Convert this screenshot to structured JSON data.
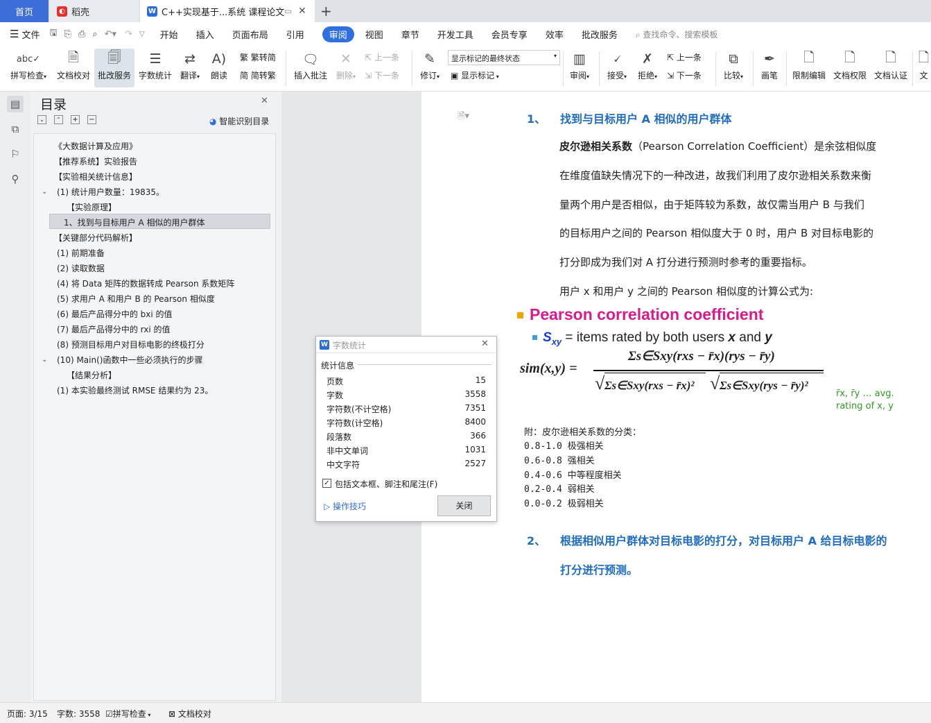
{
  "tabs": {
    "home": "首页",
    "daoke": "稻壳",
    "doc": "C++实现基于...系统 课程论文"
  },
  "menu": {
    "file": "文件",
    "items": [
      "开始",
      "插入",
      "页面布局",
      "引用",
      "审阅",
      "视图",
      "章节",
      "开发工具",
      "会员专享",
      "效率",
      "批改服务"
    ],
    "active": "审阅",
    "search_placeholder": "查找命令、搜索模板"
  },
  "ribbon": {
    "spell_check": "拼写检查",
    "doc_proof": "文档校对",
    "correction_service": "批改服务",
    "word_count": "字数统计",
    "translate": "翻译",
    "read_aloud": "朗读",
    "trad_to_simp": "繁转简",
    "simp_to_trad": "简转繁",
    "insert_comment": "插入批注",
    "delete": "删除",
    "prev": "上一条",
    "next": "下一条",
    "revise": "修订",
    "markup_state": "显示标记的最终状态",
    "show_markup": "显示标记",
    "review": "审阅",
    "accept": "接受",
    "reject": "拒绝",
    "prev2": "上一条",
    "next2": "下一条",
    "compare": "比较",
    "pen": "画笔",
    "restrict_edit": "限制编辑",
    "doc_permission": "文档权限",
    "doc_cert": "文档认证",
    "doc_more": "文"
  },
  "toc": {
    "title": "目录",
    "smart_label": "智能识别目录",
    "items": [
      "《大数据计算及应用》",
      "【推荐系统】实验报告",
      "【实验相关统计信息】",
      "(1) 统计用户数量：19835。",
      "【实验原理】",
      "1、找到与目标用户 A 相似的用户群体",
      "【关键部分代码解析】",
      "(1) 前期准备",
      "(2) 读取数据",
      "(4) 将 Data 矩阵的数据转成 Pearson 系数矩阵",
      "(5) 求用户 A 和用户 B 的 Pearson 相似度",
      "(6) 最后产品得分中的 bxi 的值",
      "(7) 最后产品得分中的 rxi 的值",
      "(8) 预测目标用户对目标电影的终极打分",
      "(10) Main()函数中一些必须执行的步骤",
      "【结果分析】",
      "(1) 本实验最终测试 RMSE 结果约为 23。"
    ]
  },
  "document": {
    "h1_num": "1、",
    "h1_text": "找到与目标用户 A 相似的用户群体",
    "p1_bold": "皮尔逊相关系数",
    "p1_line1_rest": "（Pearson Correlation Coefficient）是余弦相似度",
    "p1_line2": "在维度值缺失情况下的一种改进，故我们利用了皮尔逊相关系数来衡",
    "p1_line3": "量两个用户是否相似，由于矩阵较为系数，故仅需当用户 B 与我们",
    "p1_line4": "的目标用户之间的 Pearson 相似度大于 0 时，用户 B 对目标电影的",
    "p1_line5": "打分即成为我们对 A 打分进行预测时参考的重要指标。",
    "p2": "用户 x 和用户 y 之间的 Pearson 相似度的计算公式为:",
    "formula_title": "Pearson correlation coefficient",
    "formula_sub_s": "S",
    "formula_sub_xy": "xy",
    "formula_sub_text": " = items rated by both users ",
    "formula_sub_x": "x",
    "formula_sub_and": " and ",
    "formula_sub_y": "y",
    "formula_lhs": "sim(x,y) =",
    "formula_num": "Σs∈Sxy(rxs − r̄x)(rys − r̄y)",
    "formula_den1": "Σs∈Sxy(rxs − r̄x)²",
    "formula_den2": "Σs∈Sxy(rys − r̄y)²",
    "formula_note1": "r̄x, r̄y … avg.",
    "formula_note2": "rating of x, y",
    "appendix_title": "附：皮尔逊相关系数的分类：",
    "appendix": [
      "0.8-1.0 极强相关",
      "0.6-0.8 强相关",
      "0.4-0.6 中等程度相关",
      "0.2-0.4 弱相关",
      "0.0-0.2 极弱相关"
    ],
    "h2_num": "2、",
    "h2_line1": "根据相似用户群体对目标电影的打分，对目标用户 A 给目标电影的",
    "h2_line2": "打分进行预测。"
  },
  "dialog": {
    "title": "字数统计",
    "section": "统计信息",
    "rows": [
      {
        "label": "页数",
        "value": "15"
      },
      {
        "label": "字数",
        "value": "3558"
      },
      {
        "label": "字符数(不计空格)",
        "value": "7351"
      },
      {
        "label": "字符数(计空格)",
        "value": "8400"
      },
      {
        "label": "段落数",
        "value": "366"
      },
      {
        "label": "非中文单词",
        "value": "1031"
      },
      {
        "label": "中文字符",
        "value": "2527"
      }
    ],
    "checkbox_label": "包括文本框、脚注和尾注(F)",
    "tips": "操作技巧",
    "close": "关闭"
  },
  "status": {
    "page": "页面: 3/15",
    "words": "字数: 3558",
    "spell": "拼写检查",
    "proof": "文档校对"
  },
  "colors": {
    "accent": "#2f6fe0",
    "heading": "#1f6cc0",
    "formula_title": "#d81b8c",
    "formula_blue": "#1a3fd8",
    "formula_green": "#2f9a1e"
  }
}
